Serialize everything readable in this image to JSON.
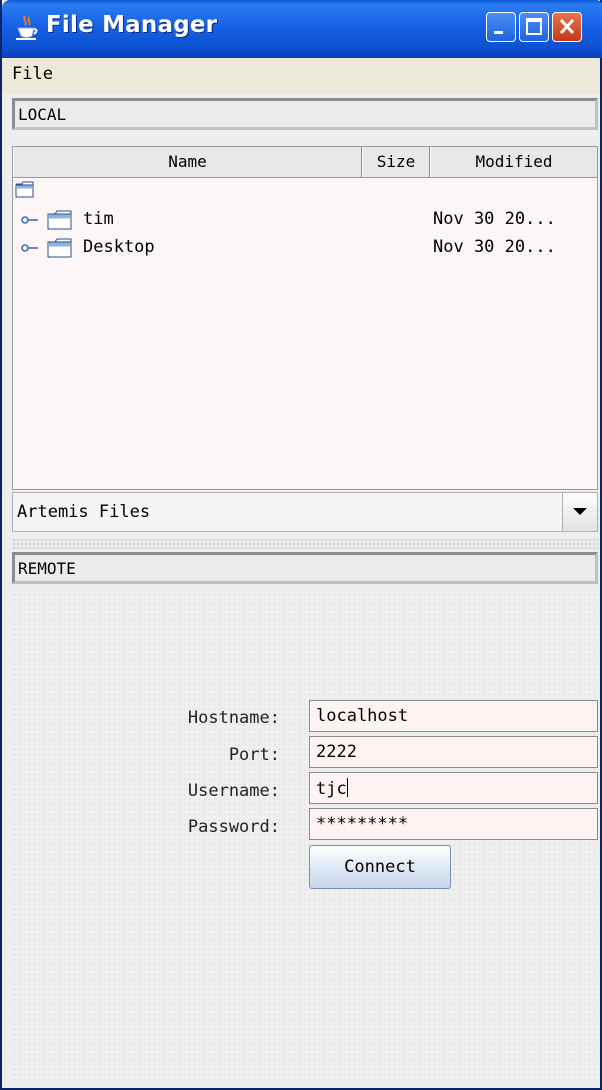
{
  "window": {
    "title": "File Manager",
    "icon": "java-cup-icon"
  },
  "menubar": {
    "file": "File"
  },
  "local": {
    "label": "LOCAL",
    "columns": [
      "Name",
      "Size",
      "Modified"
    ],
    "rows": [
      {
        "name": "tim",
        "size": "",
        "modified": "Nov 30 20..."
      },
      {
        "name": "Desktop",
        "size": "",
        "modified": "Nov 30 20..."
      }
    ],
    "combo_value": "Artemis Files"
  },
  "remote": {
    "label": "REMOTE",
    "hostname_label": "Hostname:",
    "hostname": "localhost",
    "port_label": "Port:",
    "port": "2222",
    "username_label": "Username:",
    "username": "tjc",
    "password_label": "Password:",
    "password": "*********",
    "connect_label": "Connect"
  },
  "colors": {
    "titlebar": "#1761e6",
    "field_bg": "#fdf3f3",
    "close_button": "#c5371a"
  }
}
